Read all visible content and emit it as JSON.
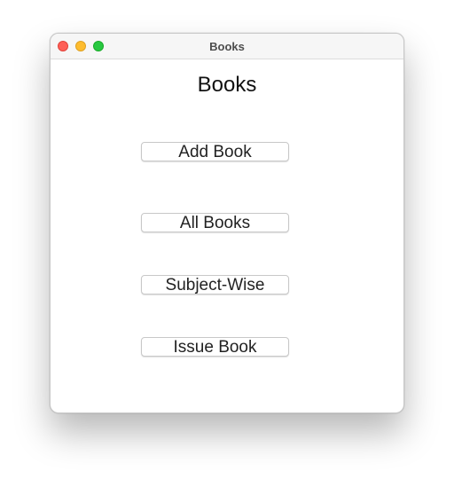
{
  "window": {
    "title": "Books"
  },
  "main": {
    "heading": "Books",
    "buttons": {
      "add_book": "Add Book",
      "all_books": "All Books",
      "subject_wise": "Subject-Wise",
      "issue_book": "Issue Book"
    }
  },
  "colors": {
    "close": "#fe5f57",
    "minimize": "#febc2e",
    "zoom": "#28c840",
    "titlebar": "#f6f6f6"
  },
  "icons": [
    "close-icon",
    "minimize-icon",
    "zoom-icon"
  ]
}
